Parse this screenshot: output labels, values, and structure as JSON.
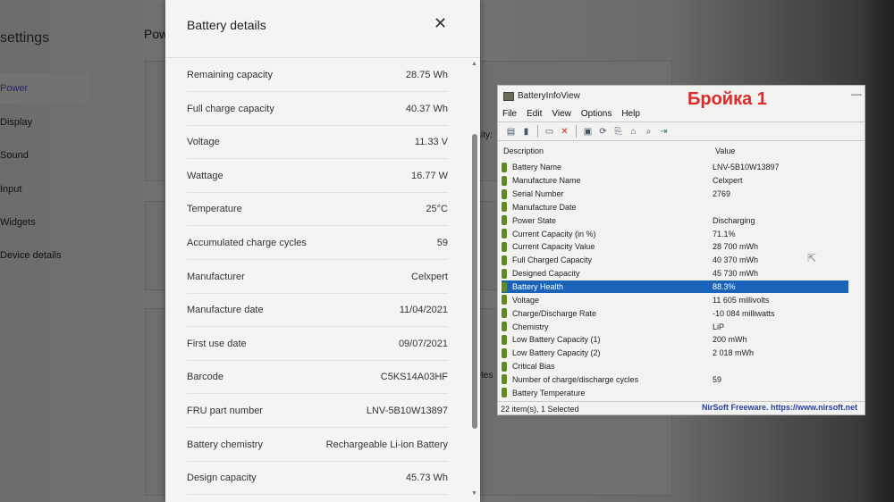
{
  "settings": {
    "title": "settings",
    "page_title": "Pow",
    "items": [
      "Power",
      "Display",
      "Sound",
      "Input",
      "Widgets",
      "Device details"
    ],
    "peek": [
      "ity:",
      "tes"
    ]
  },
  "battery_details": {
    "title": "Battery details",
    "rows": [
      {
        "label": "Remaining capacity",
        "value": "28.75 Wh"
      },
      {
        "label": "Full charge capacity",
        "value": "40.37 Wh"
      },
      {
        "label": "Voltage",
        "value": "11.33 V"
      },
      {
        "label": "Wattage",
        "value": "16.77 W"
      },
      {
        "label": "Temperature",
        "value": "25°C"
      },
      {
        "label": "Accumulated charge cycles",
        "value": "59"
      },
      {
        "label": "Manufacturer",
        "value": "Celxpert"
      },
      {
        "label": "Manufacture date",
        "value": "11/04/2021"
      },
      {
        "label": "First use date",
        "value": "09/07/2021"
      },
      {
        "label": "Barcode",
        "value": "C5KS14A03HF"
      },
      {
        "label": "FRU part number",
        "value": "LNV-5B10W13897"
      },
      {
        "label": "Battery chemistry",
        "value": "Rechargeable Li-ion Battery"
      },
      {
        "label": "Design capacity",
        "value": "45.73 Wh"
      }
    ]
  },
  "biv": {
    "title": "BatteryInfoView",
    "overlay_text": "Бройка 1",
    "menu": [
      "File",
      "Edit",
      "View",
      "Options",
      "Help"
    ],
    "columns": [
      "Description",
      "Value"
    ],
    "rows": [
      {
        "d": "Battery Name",
        "v": "LNV-5B10W13897"
      },
      {
        "d": "Manufacture Name",
        "v": "Celxpert"
      },
      {
        "d": "Serial Number",
        "v": "2769"
      },
      {
        "d": "Manufacture Date",
        "v": ""
      },
      {
        "d": "Power State",
        "v": "Discharging"
      },
      {
        "d": "Current Capacity (in %)",
        "v": "71.1%"
      },
      {
        "d": "Current Capacity Value",
        "v": "28 700 mWh"
      },
      {
        "d": "Full Charged Capacity",
        "v": "40 370 mWh"
      },
      {
        "d": "Designed Capacity",
        "v": "45 730 mWh"
      },
      {
        "d": "Battery Health",
        "v": "88.3%",
        "selected": true
      },
      {
        "d": "Voltage",
        "v": "11 605 millivolts"
      },
      {
        "d": "Charge/Discharge Rate",
        "v": "-10 084 milliwatts"
      },
      {
        "d": "Chemistry",
        "v": "LiP"
      },
      {
        "d": "Low Battery Capacity (1)",
        "v": "200 mWh"
      },
      {
        "d": "Low Battery Capacity (2)",
        "v": "2 018 mWh"
      },
      {
        "d": "Critical Bias",
        "v": ""
      },
      {
        "d": "Number of charge/discharge cycles",
        "v": "59"
      },
      {
        "d": "Battery Temperature",
        "v": ""
      }
    ],
    "status": "22 item(s), 1 Selected",
    "nirsoft": "NirSoft Freeware. https://www.nirsoft.net"
  },
  "colors": {
    "selection": "#1b63b8",
    "overlay": "#e02a2a",
    "battery_icon": "#5d8a22"
  }
}
